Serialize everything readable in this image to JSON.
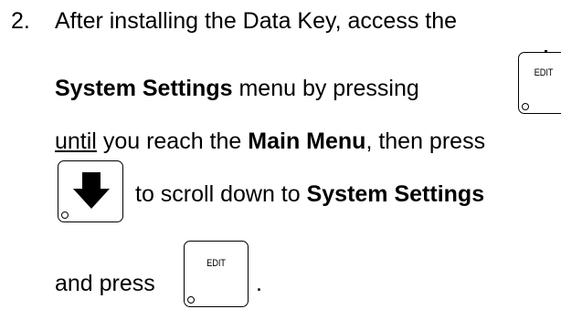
{
  "instruction": {
    "number": "2.",
    "line1": "After installing the Data Key, access the",
    "line2_bold": "System Settings",
    "line2_rest": " menu by pressing",
    "line3_underline": "until",
    "line3_mid": " you reach the ",
    "line3_bold": "Main Menu",
    "line3_end": ", then press",
    "line4_mid": "to scroll down to ",
    "line4_bold": "System Settings",
    "line5_text": "and press",
    "line5_end": "."
  },
  "keys": {
    "edit_label": "EDIT",
    "arrow_icon": "down-arrow-icon"
  }
}
